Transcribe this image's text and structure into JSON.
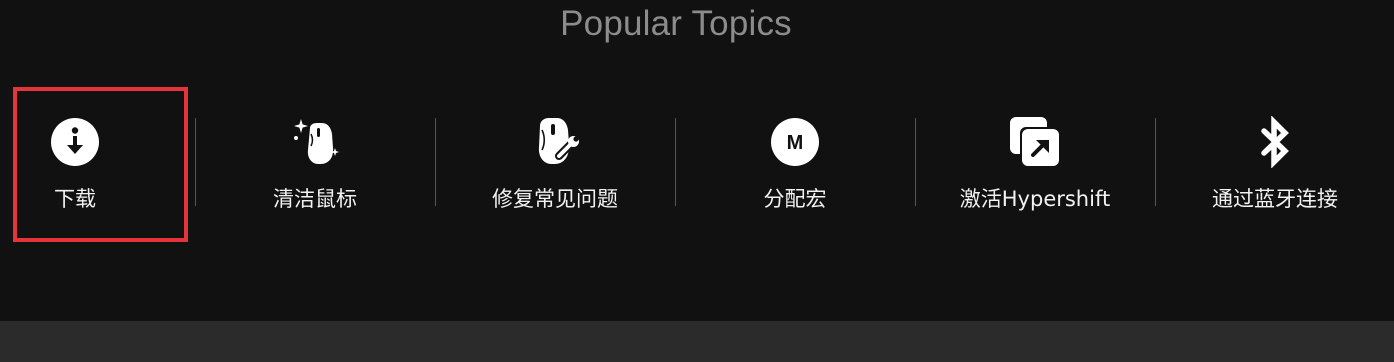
{
  "header": {
    "title": "Popular Topics"
  },
  "topics": [
    {
      "label": "下载",
      "icon": "download-icon"
    },
    {
      "label": "清洁鼠标",
      "icon": "mouse-clean-icon"
    },
    {
      "label": "修复常见问题",
      "icon": "mouse-repair-icon"
    },
    {
      "label": "分配宏",
      "icon": "macro-icon",
      "icon_text": "M"
    },
    {
      "label": "激活Hypershift",
      "icon": "hypershift-icon"
    },
    {
      "label": "通过蓝牙连接",
      "icon": "bluetooth-icon"
    }
  ],
  "colors": {
    "background": "#111111",
    "title": "#8c8c8c",
    "highlight": "#e4353a",
    "footer": "#2b2b2b"
  }
}
